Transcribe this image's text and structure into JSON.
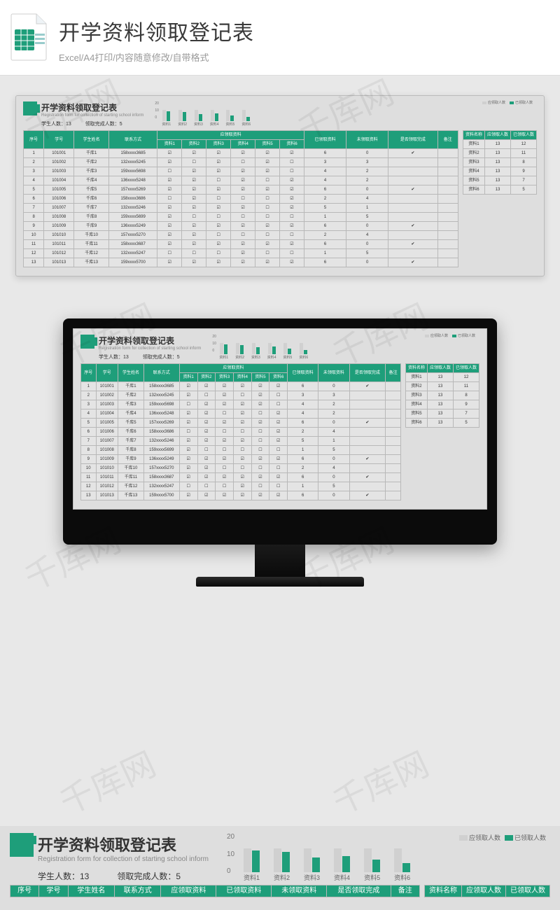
{
  "hero": {
    "title": "开学资料领取登记表",
    "subtitle": "Excel/A4打印/内容随意修改/自带格式"
  },
  "sheet": {
    "title": "开学资料领取登记表",
    "subtitle": "Registration form for collection of starting school inform",
    "student_count_label": "学生人数：",
    "student_count": "13",
    "complete_label": "领取完成人数：",
    "complete_count": "5",
    "chart_yticks": [
      "20",
      "10",
      "0"
    ],
    "legend_a": "应领取人数",
    "legend_b": "已领取人数",
    "main_headers": {
      "seq": "序号",
      "id": "学号",
      "name": "学生姓名",
      "contact": "联系方式",
      "group": "应领取资料",
      "received": "已领取资料",
      "unreceived": "未领取资料",
      "done": "是否领取完成",
      "remark": "备注"
    },
    "mat_cols": [
      "资料1",
      "资料2",
      "资料3",
      "资料4",
      "资料5",
      "资料6"
    ],
    "rows": [
      {
        "seq": "1",
        "id": "101001",
        "name": "千库1",
        "contact": "158xxxx3685",
        "m": [
          1,
          1,
          1,
          1,
          1,
          1
        ],
        "rec": "6",
        "un": "0",
        "done": "✔"
      },
      {
        "seq": "2",
        "id": "101002",
        "name": "千库2",
        "contact": "132xxxx5245",
        "m": [
          1,
          0,
          1,
          0,
          1,
          0
        ],
        "rec": "3",
        "un": "3",
        "done": ""
      },
      {
        "seq": "3",
        "id": "101003",
        "name": "千库3",
        "contact": "159xxxx5698",
        "m": [
          0,
          1,
          1,
          1,
          1,
          0
        ],
        "rec": "4",
        "un": "2",
        "done": ""
      },
      {
        "seq": "4",
        "id": "101004",
        "name": "千库4",
        "contact": "136xxxx5248",
        "m": [
          1,
          1,
          0,
          1,
          0,
          1
        ],
        "rec": "4",
        "un": "2",
        "done": ""
      },
      {
        "seq": "5",
        "id": "101005",
        "name": "千库5",
        "contact": "157xxxx5269",
        "m": [
          1,
          1,
          1,
          1,
          1,
          1
        ],
        "rec": "6",
        "un": "0",
        "done": "✔"
      },
      {
        "seq": "6",
        "id": "101006",
        "name": "千库6",
        "contact": "158xxxx3686",
        "m": [
          0,
          1,
          0,
          0,
          0,
          1
        ],
        "rec": "2",
        "un": "4",
        "done": ""
      },
      {
        "seq": "7",
        "id": "101007",
        "name": "千库7",
        "contact": "132xxxx5246",
        "m": [
          1,
          1,
          1,
          1,
          0,
          1
        ],
        "rec": "5",
        "un": "1",
        "done": ""
      },
      {
        "seq": "8",
        "id": "101008",
        "name": "千库8",
        "contact": "159xxxx5699",
        "m": [
          1,
          0,
          0,
          0,
          0,
          0
        ],
        "rec": "1",
        "un": "5",
        "done": ""
      },
      {
        "seq": "9",
        "id": "101009",
        "name": "千库9",
        "contact": "136xxxx5249",
        "m": [
          1,
          1,
          1,
          1,
          1,
          1
        ],
        "rec": "6",
        "un": "0",
        "done": "✔"
      },
      {
        "seq": "10",
        "id": "101010",
        "name": "千库10",
        "contact": "157xxxx5270",
        "m": [
          1,
          1,
          0,
          0,
          0,
          0
        ],
        "rec": "2",
        "un": "4",
        "done": ""
      },
      {
        "seq": "11",
        "id": "101011",
        "name": "千库11",
        "contact": "158xxxx3687",
        "m": [
          1,
          1,
          1,
          1,
          1,
          1
        ],
        "rec": "6",
        "un": "0",
        "done": "✔"
      },
      {
        "seq": "12",
        "id": "101012",
        "name": "千库12",
        "contact": "132xxxx5247",
        "m": [
          0,
          0,
          0,
          1,
          0,
          0
        ],
        "rec": "1",
        "un": "5",
        "done": ""
      },
      {
        "seq": "13",
        "id": "101013",
        "name": "千库13",
        "contact": "159xxxx5700",
        "m": [
          1,
          1,
          1,
          1,
          1,
          1
        ],
        "rec": "6",
        "un": "0",
        "done": "✔"
      }
    ],
    "side_headers": {
      "name": "资料名称",
      "should": "应领取人数",
      "got": "已领取人数"
    },
    "side_rows": [
      {
        "name": "资料1",
        "should": "13",
        "got": "12"
      },
      {
        "name": "资料2",
        "should": "13",
        "got": "11"
      },
      {
        "name": "资料3",
        "should": "13",
        "got": "8"
      },
      {
        "name": "资料4",
        "should": "13",
        "got": "9"
      },
      {
        "name": "资料5",
        "should": "13",
        "got": "7"
      },
      {
        "name": "资料6",
        "should": "13",
        "got": "5"
      }
    ]
  },
  "chart_data": {
    "type": "bar",
    "categories": [
      "资料1",
      "资料2",
      "资料3",
      "资料4",
      "资料5",
      "资料6"
    ],
    "series": [
      {
        "name": "应领取人数",
        "values": [
          13,
          13,
          13,
          13,
          13,
          13
        ]
      },
      {
        "name": "已领取人数",
        "values": [
          12,
          11,
          8,
          9,
          7,
          5
        ]
      }
    ],
    "ylim": [
      0,
      20
    ],
    "yticks": [
      0,
      10,
      20
    ],
    "title": "",
    "xlabel": "",
    "ylabel": ""
  },
  "watermark": "千库网"
}
